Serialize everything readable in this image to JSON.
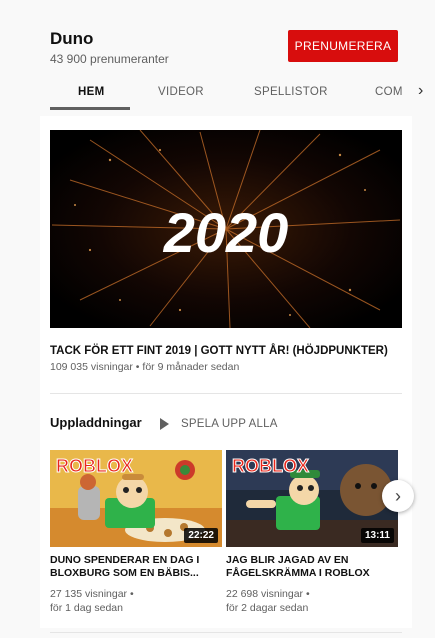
{
  "channel": {
    "name": "Duno",
    "subscribers": "43 900 prenumeranter",
    "subscribe_label": "PRENUMERERA"
  },
  "tabs": [
    {
      "label": "HEM"
    },
    {
      "label": "VIDEOR"
    },
    {
      "label": "SPELLISTOR"
    },
    {
      "label": "COM"
    }
  ],
  "featured": {
    "thumb_text": "2020",
    "title": "TACK FÖR ETT FINT 2019 | GOTT NYTT ÅR! (HÖJDPUNKTER)",
    "meta": "109 035 visningar • för 9 månader sedan"
  },
  "uploads": {
    "title": "Uppladdningar",
    "play_all": "SPELA UPP ALLA",
    "items": [
      {
        "thumb_logo": "ROBLOX",
        "duration": "22:22",
        "title": "DUNO SPENDERAR EN DAG I BLOXBURG SOM EN BÄBIS...",
        "views": "27 135 visningar •",
        "age": "för 1 dag sedan"
      },
      {
        "thumb_logo": "ROBLOX",
        "duration": "13:11",
        "title": "JAG BLIR JAGAD AV EN FÅGELSKRÄMMA I ROBLOX",
        "views": "22 698 visningar •",
        "age": "för 2 dagar sedan"
      }
    ]
  },
  "colors": {
    "brand_red": "#d80d0d",
    "text_primary": "#111111",
    "text_secondary": "#606060"
  },
  "icons": {
    "tabs_next": "chevron-right-icon",
    "play_all": "play-icon",
    "shelf_next": "chevron-right-icon"
  }
}
